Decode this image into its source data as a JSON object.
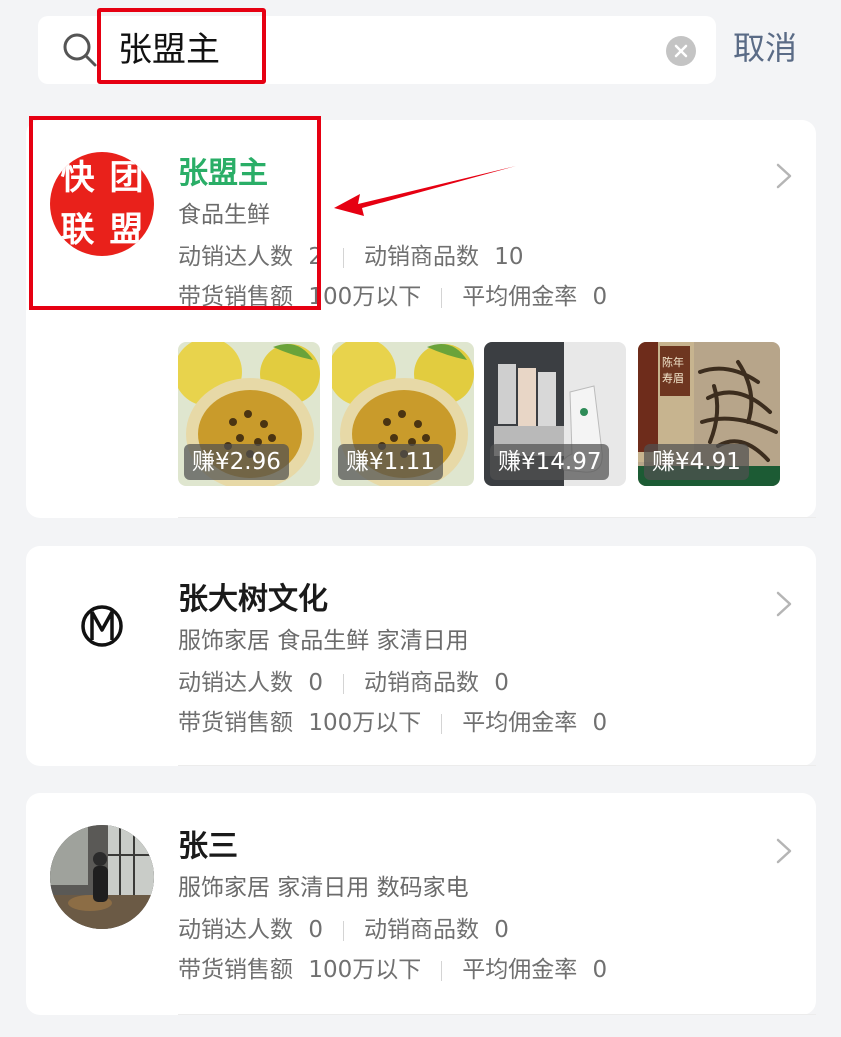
{
  "search": {
    "query": "张盟主",
    "cancel_label": "取消"
  },
  "results": [
    {
      "avatar_text": [
        "快",
        "团",
        "联",
        "盟"
      ],
      "name": "张盟主",
      "categories": "食品生鲜",
      "stats": {
        "promoters_label": "动销达人数",
        "promoters_value": "2",
        "products_label": "动销商品数",
        "products_value": "10",
        "sales_label": "带货销售额",
        "sales_value": "100万以下",
        "commission_label": "平均佣金率",
        "commission_value": "0"
      },
      "products": [
        {
          "earn": "赚¥2.96",
          "image": "passion-fruit"
        },
        {
          "earn": "赚¥1.11",
          "image": "passion-fruit"
        },
        {
          "earn": "赚¥14.97",
          "image": "socks"
        },
        {
          "earn": "赚¥4.91",
          "image": "tea-leaves"
        }
      ]
    },
    {
      "avatar_icon": "m-logo-icon",
      "name": "张大树文化",
      "categories": "服饰家居 食品生鲜 家清日用",
      "stats": {
        "promoters_label": "动销达人数",
        "promoters_value": "0",
        "products_label": "动销商品数",
        "products_value": "0",
        "sales_label": "带货销售额",
        "sales_value": "100万以下",
        "commission_label": "平均佣金率",
        "commission_value": "0"
      }
    },
    {
      "avatar_icon": "person-photo-icon",
      "name": "张三",
      "categories": "服饰家居 家清日用 数码家电",
      "stats": {
        "promoters_label": "动销达人数",
        "promoters_value": "0",
        "products_label": "动销商品数",
        "products_value": "0",
        "sales_label": "带货销售额",
        "sales_value": "100万以下",
        "commission_label": "平均佣金率",
        "commission_value": "0"
      }
    }
  ],
  "tea_package_text": [
    "陈年",
    "寿眉"
  ],
  "colors": {
    "accent_green": "#2aae67",
    "annotation_red": "#e60012",
    "cancel_blue": "#5a6b86",
    "logo_red": "#e9211b"
  }
}
